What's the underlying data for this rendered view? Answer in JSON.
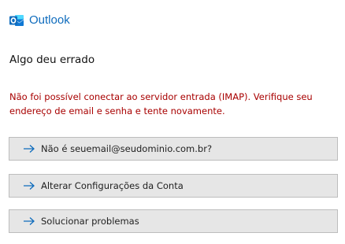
{
  "header": {
    "app_name": "Outlook",
    "logo_icon": "outlook-logo-icon",
    "brand_color": "#0F6CBD"
  },
  "main": {
    "heading": "Algo deu errado",
    "error_message": "Não foi possível conectar ao servidor entrada (IMAP). Verifique seu endereço de email e senha e tente novamente.",
    "error_color": "#A80000",
    "actions": [
      {
        "label": "Não é seuemail@seudominio.com.br?",
        "icon": "arrow-right-icon"
      },
      {
        "label": "Alterar Configurações da Conta",
        "icon": "arrow-right-icon"
      },
      {
        "label": "Solucionar problemas",
        "icon": "arrow-right-icon"
      }
    ]
  }
}
